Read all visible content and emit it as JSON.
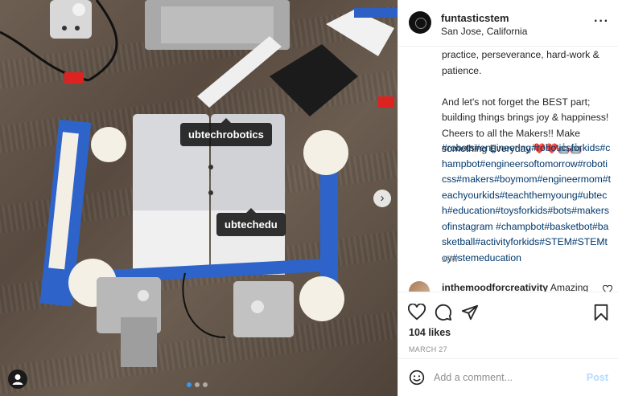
{
  "photo": {
    "tags": [
      "ubtechrobotics",
      "ubtechedu"
    ],
    "carousel": {
      "count": 3,
      "active_index": 0
    },
    "icons": {
      "next": "chevron-right-icon",
      "user_tags": "person-icon"
    }
  },
  "post": {
    "username": "funtasticstem",
    "location": "San Jose, California",
    "more_label": "···",
    "caption": "practice, perseverance, hard-work &\npatience.\n\nAnd let's not forget the BEST part;\nbuilding things brings joy & happiness!\nCheers to all the Makers!! Make\nsomething Everyday ❤️❤️🤖🤖",
    "hashtags": "#robots#engineering#roboticsforkids#champbot#engineersoftomorrow#roboticss#makers#boymom#engineermom#teachyourkids#teachthemyoung#ubtech#education#toysforkids#bots#makersofinstagram #champbot#basketbot#basketball#activityforkids#STEM#STEMtoy#stemeducation",
    "time_ago": "18w",
    "comment": {
      "username": "inthemoodforcreativity",
      "text": "Amazing"
    },
    "likes": "104 likes",
    "date": "MARCH 27",
    "comment_placeholder": "Add a comment...",
    "post_label": "Post",
    "colors": {
      "hashtag": "#00376b",
      "post_disabled": "#b3dbff",
      "carousel_active": "#3897f0"
    }
  }
}
